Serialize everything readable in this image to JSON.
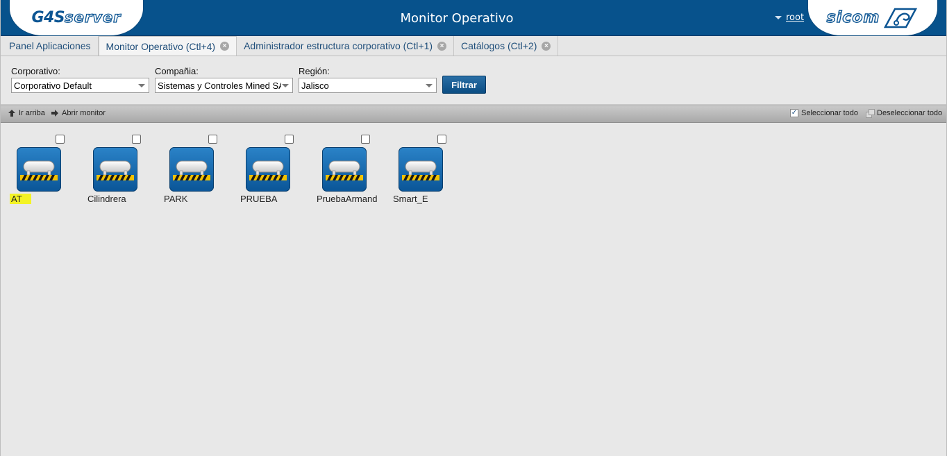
{
  "header": {
    "logo_left_main": "G4S",
    "logo_left_sub": "server",
    "title": "Monitor Operativo",
    "user": "root",
    "logo_right": "sicom",
    "colors": {
      "bar": "#07528c",
      "accent": "#0c5593"
    }
  },
  "tabs": [
    {
      "label": "Panel Aplicaciones",
      "closable": false,
      "active": false
    },
    {
      "label": "Monitor Operativo (Ctl+4)",
      "closable": true,
      "active": true
    },
    {
      "label": "Administrador estructura corporativo (Ctl+1)",
      "closable": true,
      "active": false
    },
    {
      "label": "Catálogos (Ctl+2)",
      "closable": true,
      "active": false
    }
  ],
  "filters": {
    "corporativo": {
      "label": "Corporativo:",
      "value": "Corporativo Default"
    },
    "compania": {
      "label": "Compañia:",
      "value": "Sistemas y Controles Mined SA"
    },
    "region": {
      "label": "Región:",
      "value": "Jalisco"
    },
    "filter_button": "Filtrar"
  },
  "toolbar": {
    "up": "Ir arriba",
    "open": "Abrir monitor",
    "select_all": "Seleccionar todo",
    "deselect_all": "Deseleccionar todo"
  },
  "stations": [
    {
      "name": "AT",
      "highlighted": true,
      "icon": "tank-icon"
    },
    {
      "name": "Cilindrera",
      "highlighted": false,
      "icon": "tank-icon"
    },
    {
      "name": "PARK",
      "highlighted": false,
      "icon": "tank-icon"
    },
    {
      "name": "PRUEBA",
      "highlighted": false,
      "icon": "tank-icon"
    },
    {
      "name": "PruebaArmand",
      "highlighted": false,
      "icon": "tank-icon"
    },
    {
      "name": "Smart_E",
      "highlighted": false,
      "icon": "tank-icon"
    }
  ]
}
